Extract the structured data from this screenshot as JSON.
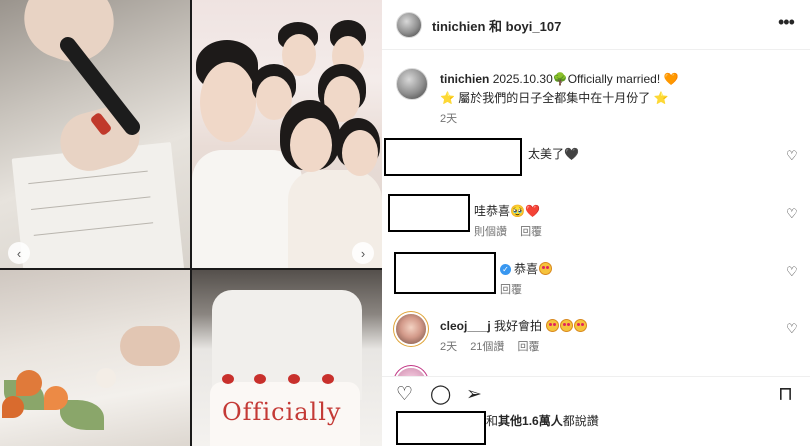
{
  "post": {
    "header_title": "tinichien 和 boyi_107",
    "more_icon": "more-horizontal-icon",
    "caption": {
      "username": "tinichien",
      "line1": "2025.10.30🌳Officially married!",
      "heart": "🧡",
      "line2_star_left": "⭐",
      "line2": "屬於我們的日子全都集中在十月份了",
      "line2_star_right": "⭐",
      "time": "2天"
    },
    "photo_text": "Officially",
    "comments": [
      {
        "text": "太美了",
        "emoji": "🖤",
        "like_icon": "heart-outline-icon"
      },
      {
        "text": "哇恭喜🥹",
        "emoji": "❤️",
        "likes": "則個讚",
        "reply": "回覆",
        "like_icon": "heart-outline-icon"
      },
      {
        "verified": "✓",
        "text": "恭喜",
        "emoji": "🥰",
        "reply": "回覆",
        "like_icon": "heart-outline-icon"
      },
      {
        "username": "cleoj___j",
        "text": "我好會拍",
        "emojis": "🥰🥰🥰",
        "time": "2天",
        "likes": "21個讚",
        "reply": "回覆",
        "like_icon": "heart-outline-icon"
      },
      {
        "like_icon": "heart-outline-icon"
      }
    ],
    "actions": {
      "like": "♡",
      "comment": "◯",
      "share": "➢",
      "save": "⊓"
    },
    "likes_line": {
      "prefix": "和",
      "bold": "其他1.6萬人",
      "suffix": "都說讚"
    },
    "date_partial": "2天"
  },
  "colors": {
    "text": "#262626",
    "muted": "#737373",
    "verified": "#3897f0",
    "brand_orange": "#e8772e"
  }
}
